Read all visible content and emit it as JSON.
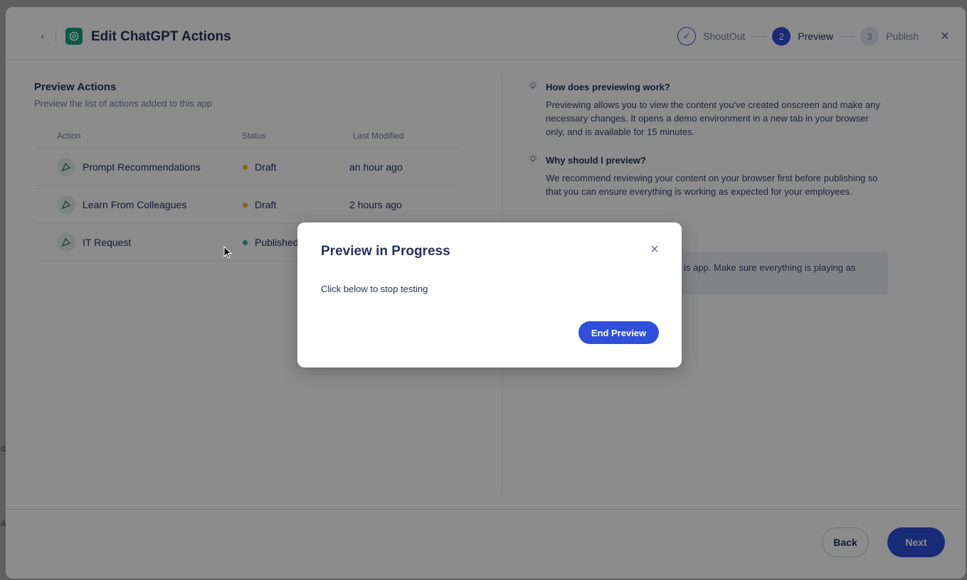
{
  "background": {
    "edge_letters": [
      "d",
      "A"
    ]
  },
  "header": {
    "title": "Edit ChatGPT Actions",
    "logo_icon": "chatgpt-logo-icon",
    "steps": [
      {
        "number": "✓",
        "label": "ShoutOut",
        "state": "done"
      },
      {
        "number": "2",
        "label": "Preview",
        "state": "active"
      },
      {
        "number": "3",
        "label": "Publish",
        "state": "todo"
      }
    ]
  },
  "left": {
    "title": "Preview Actions",
    "subtitle": "Preview the list of actions added to this app",
    "columns": {
      "action": "Action",
      "status": "Status",
      "modified": "Last Modified"
    },
    "rows": [
      {
        "action": "Prompt Recommendations",
        "status": "Draft",
        "status_color": "#f0b429",
        "modified": "an hour ago"
      },
      {
        "action": "Learn From Colleagues",
        "status": "Draft",
        "status_color": "#f0b429",
        "modified": "2 hours ago"
      },
      {
        "action": "IT Request",
        "status": "Published",
        "status_color": "#2bb39a",
        "modified": ""
      }
    ]
  },
  "right": {
    "q1": "How does previewing work?",
    "a1": "Previewing allows you to view the content you've created onscreen and make any necessary changes. It opens a demo environment in a new tab in your browser only, and is available for 15 minutes.",
    "q2": "Why should I preview?",
    "a2": "We recommend reviewing your content on your browser first before publishing so that you can ensure everything is working as expected for your employees.",
    "tip_visible": "is app. Make sure everything is playing as"
  },
  "footer": {
    "back": "Back",
    "next": "Next"
  },
  "modal": {
    "title": "Preview in Progress",
    "body": "Click below to stop testing",
    "button": "End Preview"
  },
  "colors": {
    "accent": "#2f4fd8",
    "draft": "#f0b429",
    "published": "#2bb39a"
  }
}
